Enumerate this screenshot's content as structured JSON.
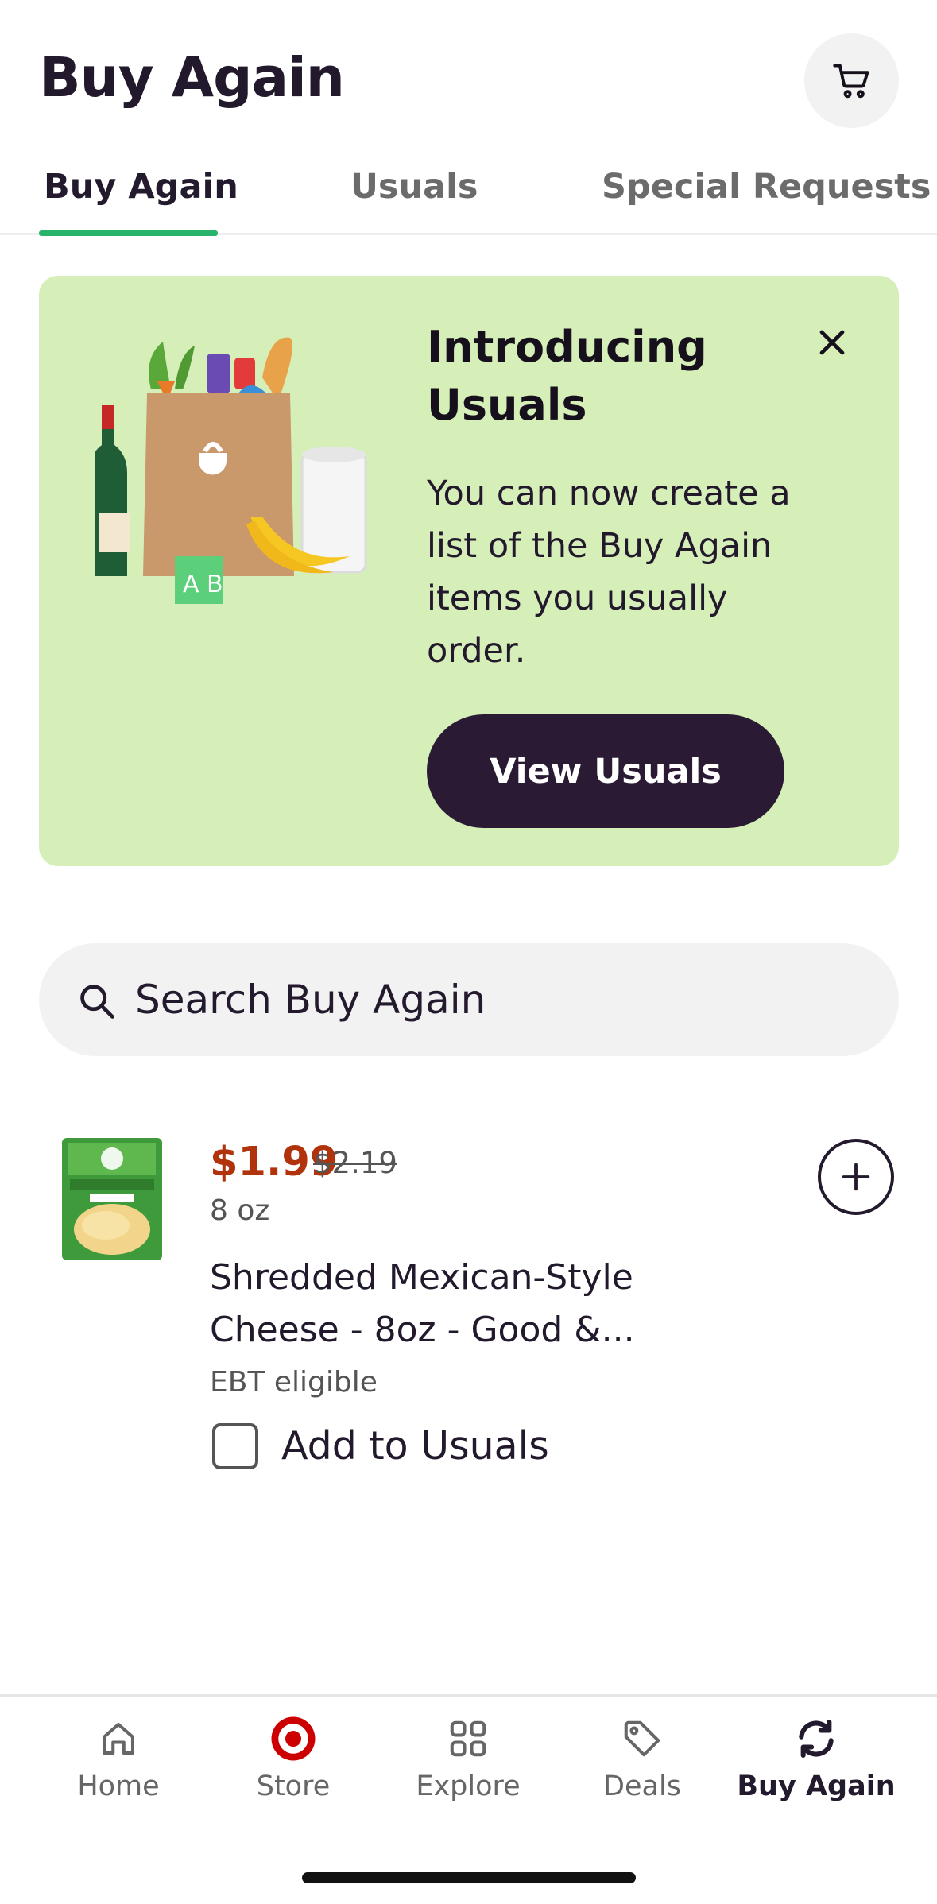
{
  "header": {
    "title": "Buy Again",
    "cart_icon": "cart-icon"
  },
  "tabs": [
    {
      "label": "Buy Again",
      "active": true
    },
    {
      "label": "Usuals",
      "active": false
    },
    {
      "label": "Special Requests",
      "active": false
    }
  ],
  "promo": {
    "title": "Introducing Usuals",
    "body": "You can now create a list of the Buy Again items you usually order.",
    "button_label": "View Usuals",
    "close_icon": "close-icon",
    "background_color": "#d6efb9"
  },
  "search": {
    "placeholder": "Search Buy Again",
    "value": ""
  },
  "products": [
    {
      "price": "$1.99",
      "original_price": "$2.19",
      "size": "8 oz",
      "name": "Shredded Mexican-Style Cheese - 8oz - Good &...",
      "badge": "EBT eligible",
      "usuals_label": "Add to Usuals",
      "usuals_checked": false
    }
  ],
  "bottom_nav": [
    {
      "label": "Home",
      "icon": "home-icon",
      "active": false
    },
    {
      "label": "Store",
      "icon": "target-store-icon",
      "active": false
    },
    {
      "label": "Explore",
      "icon": "grid-icon",
      "active": false
    },
    {
      "label": "Deals",
      "icon": "tag-icon",
      "active": false
    },
    {
      "label": "Buy Again",
      "icon": "refresh-icon",
      "active": true
    }
  ],
  "colors": {
    "accent": "#28b36a",
    "price": "#b0330c",
    "dark": "#2a1a33",
    "store_red": "#cc0000"
  }
}
